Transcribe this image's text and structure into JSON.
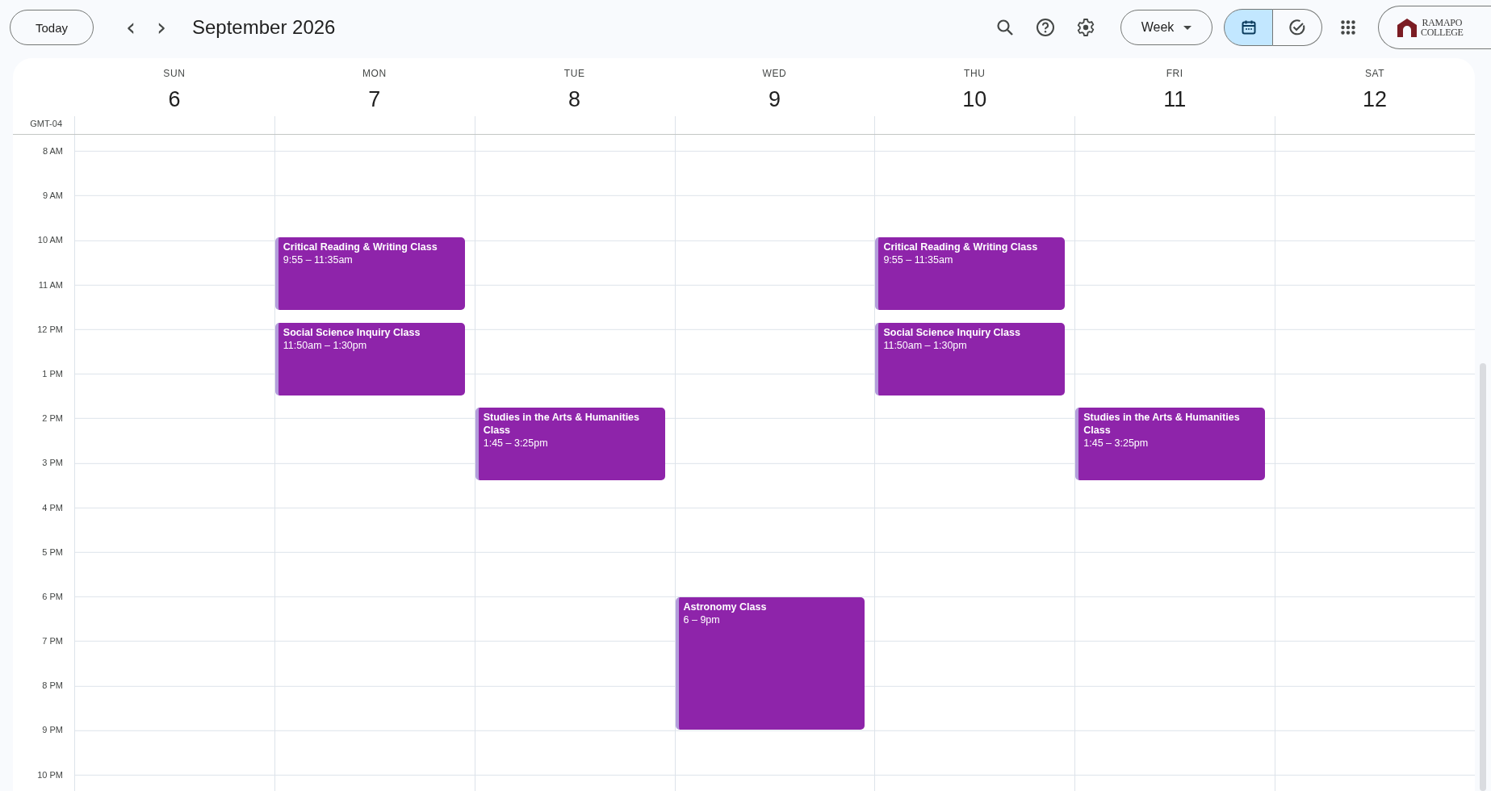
{
  "toolbar": {
    "today": "Today",
    "prev": "‹",
    "next": "›",
    "title": "September 2026",
    "view_menu": "Week",
    "view_toggle": [
      {
        "kind": "calendar",
        "selected": true
      },
      {
        "kind": "tasks",
        "selected": false
      }
    ],
    "logo": [
      "RAMAPO",
      "COLLEGE"
    ]
  },
  "timezone": "GMT-04",
  "hours": [
    "8 AM",
    "9 AM",
    "10 AM",
    "11 AM",
    "12 PM",
    "1 PM",
    "2 PM",
    "3 PM",
    "4 PM",
    "5 PM",
    "6 PM",
    "7 PM",
    "8 PM",
    "9 PM",
    "10 PM"
  ],
  "days": [
    {
      "name": "SUN",
      "number": "6"
    },
    {
      "name": "MON",
      "number": "7",
      "events": [
        {
          "title": "Critical Reading & Writing Class",
          "time": "9:55 – 11:35am"
        },
        {
          "title": "Social Science Inquiry Class",
          "time": "11:50am – 1:30pm"
        }
      ]
    },
    {
      "name": "TUE",
      "number": "8",
      "events": [
        {
          "title": "Studies in the Arts & Humanities Class",
          "time": "1:45 – 3:25pm"
        }
      ]
    },
    {
      "name": "WED",
      "number": "9",
      "events": [
        {
          "title": "Astronomy Class",
          "time": "6 – 9pm"
        }
      ]
    },
    {
      "name": "THU",
      "number": "10",
      "events": [
        {
          "title": "Critical Reading & Writing Class",
          "time": "9:55 – 11:35am"
        },
        {
          "title": "Social Science Inquiry Class",
          "time": "11:50am – 1:30pm"
        }
      ]
    },
    {
      "name": "FRI",
      "number": "11",
      "events": [
        {
          "title": "Studies in the Arts & Humanities Class",
          "time": "1:45 – 3:25pm"
        }
      ]
    },
    {
      "name": "SAT",
      "number": "12"
    }
  ]
}
